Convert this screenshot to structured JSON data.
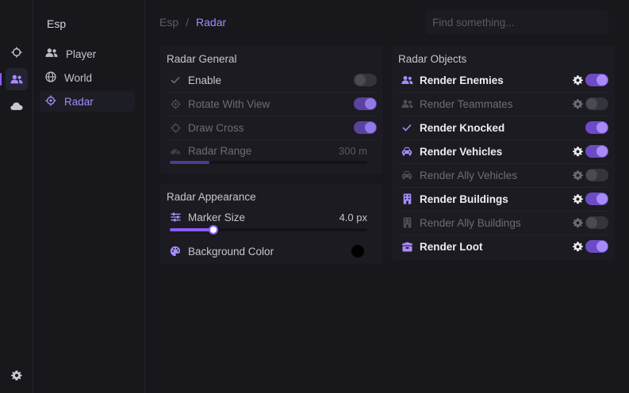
{
  "nav": {
    "title": "Esp",
    "items": [
      {
        "label": "Player",
        "icon": "users-icon"
      },
      {
        "label": "World",
        "icon": "globe-icon"
      },
      {
        "label": "Radar",
        "icon": "radar-icon",
        "active": true
      }
    ]
  },
  "rail": {
    "items": [
      {
        "icon": "crosshair-icon"
      },
      {
        "icon": "users-icon",
        "active": true
      },
      {
        "icon": "cloud-icon"
      }
    ],
    "bottom_icon": "gear-icon"
  },
  "breadcrumb": {
    "parent": "Esp",
    "separator": "/",
    "current": "Radar"
  },
  "search": {
    "placeholder": "Find something..."
  },
  "radar_general": {
    "title": "Radar General",
    "rows": [
      {
        "label": "Enable",
        "icon": "check-icon",
        "toggle": false
      },
      {
        "label": "Rotate With View",
        "icon": "radar-icon",
        "toggle": true
      },
      {
        "label": "Draw Cross",
        "icon": "crosshair-icon",
        "toggle": true
      },
      {
        "label": "Radar Range",
        "icon": "gauge-icon",
        "value": "300 m",
        "slider_fraction": 0.2
      }
    ]
  },
  "radar_appearance": {
    "title": "Radar Appearance",
    "marker_size": {
      "label": "Marker Size",
      "icon": "sliders-icon",
      "value": "4.0 px",
      "slider_fraction": 0.22
    },
    "background_color": {
      "label": "Background Color",
      "icon": "palette-icon",
      "color": "#000000"
    }
  },
  "radar_objects": {
    "title": "Radar Objects",
    "rows": [
      {
        "label": "Render Enemies",
        "icon": "users-icon",
        "gear": true,
        "toggle": true,
        "enabled": true
      },
      {
        "label": "Render Teammates",
        "icon": "users-icon",
        "gear": true,
        "toggle": false,
        "enabled": false
      },
      {
        "label": "Render Knocked",
        "icon": "check-icon",
        "gear": false,
        "toggle": true,
        "enabled": true
      },
      {
        "label": "Render Vehicles",
        "icon": "car-icon",
        "gear": true,
        "toggle": true,
        "enabled": true
      },
      {
        "label": "Render Ally Vehicles",
        "icon": "car-icon",
        "gear": true,
        "toggle": false,
        "enabled": false
      },
      {
        "label": "Render Buildings",
        "icon": "building-icon",
        "gear": true,
        "toggle": true,
        "enabled": true
      },
      {
        "label": "Render Ally Buildings",
        "icon": "building-icon",
        "gear": true,
        "toggle": false,
        "enabled": false
      },
      {
        "label": "Render Loot",
        "icon": "box-icon",
        "gear": true,
        "toggle": true,
        "enabled": true
      }
    ]
  },
  "colors": {
    "accent": "#8b5cf6",
    "accent_light": "#a78bfa",
    "background": "#17171c",
    "panel": "#1b1b21"
  }
}
